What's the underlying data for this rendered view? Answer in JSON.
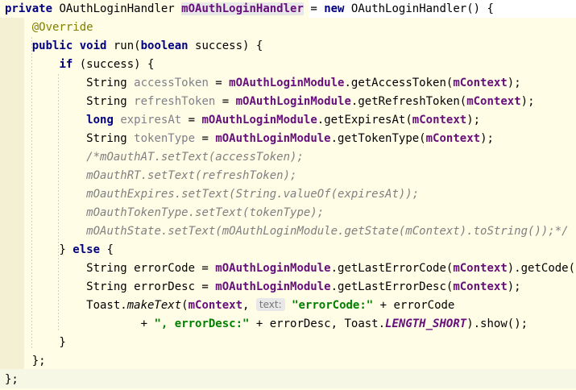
{
  "editor": {
    "lines": [
      [
        {
          "t": "private",
          "c": "kw"
        },
        {
          "t": " OAuthLoginHandler "
        },
        {
          "t": "mOAuthLoginHandler",
          "c": "fld hl"
        },
        {
          "t": " = "
        },
        {
          "t": "new",
          "c": "kw"
        },
        {
          "t": " OAuthLoginHandler() {"
        }
      ],
      [
        {
          "t": "    "
        },
        {
          "t": "@Override",
          "c": "an"
        }
      ],
      [
        {
          "t": "    "
        },
        {
          "t": "public void",
          "c": "kw"
        },
        {
          "t": " run("
        },
        {
          "t": "boolean",
          "c": "kw"
        },
        {
          "t": " success) {"
        }
      ],
      [
        {
          "t": "        "
        },
        {
          "t": "if",
          "c": "kw"
        },
        {
          "t": " (success) {"
        }
      ],
      [
        {
          "t": "            String "
        },
        {
          "t": "accessToken",
          "c": "loc"
        },
        {
          "t": " = "
        },
        {
          "t": "mOAuthLoginModule",
          "c": "fld"
        },
        {
          "t": ".getAccessToken("
        },
        {
          "t": "mContext",
          "c": "fld"
        },
        {
          "t": ");"
        }
      ],
      [
        {
          "t": "            String "
        },
        {
          "t": "refreshToken",
          "c": "loc"
        },
        {
          "t": " = "
        },
        {
          "t": "mOAuthLoginModule",
          "c": "fld"
        },
        {
          "t": ".getRefreshToken("
        },
        {
          "t": "mContext",
          "c": "fld"
        },
        {
          "t": ");"
        }
      ],
      [
        {
          "t": "            "
        },
        {
          "t": "long",
          "c": "kw"
        },
        {
          "t": " "
        },
        {
          "t": "expiresAt",
          "c": "loc"
        },
        {
          "t": " = "
        },
        {
          "t": "mOAuthLoginModule",
          "c": "fld"
        },
        {
          "t": ".getExpiresAt("
        },
        {
          "t": "mContext",
          "c": "fld"
        },
        {
          "t": ");"
        }
      ],
      [
        {
          "t": "            String "
        },
        {
          "t": "tokenType",
          "c": "loc"
        },
        {
          "t": " = "
        },
        {
          "t": "mOAuthLoginModule",
          "c": "fld"
        },
        {
          "t": ".getTokenType("
        },
        {
          "t": "mContext",
          "c": "fld"
        },
        {
          "t": ");"
        }
      ],
      [
        {
          "t": "            "
        },
        {
          "t": "/*mOauthAT.setText(accessToken);",
          "c": "cmt"
        }
      ],
      [
        {
          "t": "            "
        },
        {
          "t": "mOauthRT.setText(refreshToken);",
          "c": "cmt"
        }
      ],
      [
        {
          "t": "            "
        },
        {
          "t": "mOauthExpires.setText(String.valueOf(expiresAt));",
          "c": "cmt"
        }
      ],
      [
        {
          "t": "            "
        },
        {
          "t": "mOauthTokenType.setText(tokenType);",
          "c": "cmt"
        }
      ],
      [
        {
          "t": "            "
        },
        {
          "t": "mOAuthState.setText(mOAuthLoginModule.getState(mContext).toString());*/",
          "c": "cmt"
        }
      ],
      [
        {
          "t": "        } "
        },
        {
          "t": "else",
          "c": "kw"
        },
        {
          "t": " {"
        }
      ],
      [
        {
          "t": "            String errorCode = "
        },
        {
          "t": "mOAuthLoginModule",
          "c": "fld"
        },
        {
          "t": ".getLastErrorCode("
        },
        {
          "t": "mContext",
          "c": "fld"
        },
        {
          "t": ").getCode();"
        }
      ],
      [
        {
          "t": "            String errorDesc = "
        },
        {
          "t": "mOAuthLoginModule",
          "c": "fld"
        },
        {
          "t": ".getLastErrorDesc("
        },
        {
          "t": "mContext",
          "c": "fld"
        },
        {
          "t": ");"
        }
      ],
      [
        {
          "t": "            Toast."
        },
        {
          "t": "makeText",
          "c": "it"
        },
        {
          "t": "("
        },
        {
          "t": "mContext",
          "c": "fld"
        },
        {
          "t": ", "
        },
        {
          "t": "text:",
          "c": "hint"
        },
        {
          "t": " "
        },
        {
          "t": "\"errorCode:\"",
          "c": "str"
        },
        {
          "t": " + errorCode"
        }
      ],
      [
        {
          "t": "                    + "
        },
        {
          "t": "\", errorDesc:\"",
          "c": "str"
        },
        {
          "t": " + errorDesc, Toast."
        },
        {
          "t": "LENGTH_SHORT",
          "c": "cst"
        },
        {
          "t": ").show();"
        }
      ],
      [
        {
          "t": "        }"
        }
      ],
      [
        {
          "t": "    };"
        }
      ],
      [
        {
          "t": "};"
        }
      ]
    ]
  }
}
